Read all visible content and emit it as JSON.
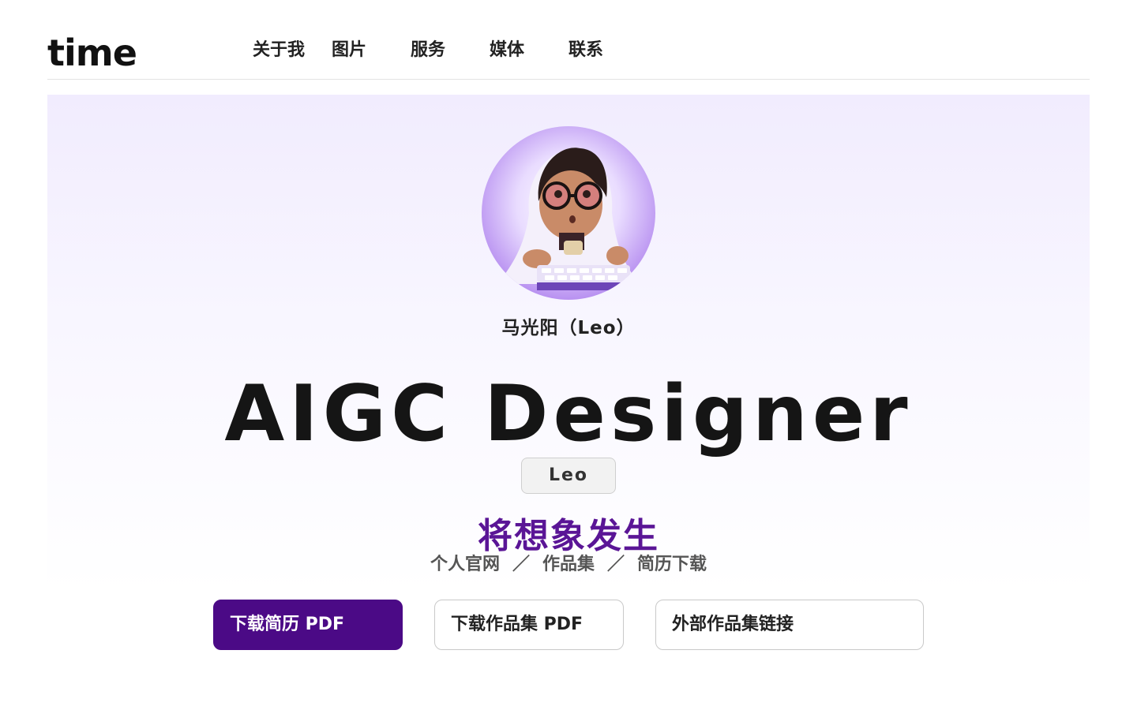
{
  "header": {
    "logo": "time",
    "nav": [
      {
        "label": "关于我"
      },
      {
        "label": "图片"
      },
      {
        "label": "服务"
      },
      {
        "label": "媒体"
      },
      {
        "label": "联系"
      }
    ]
  },
  "hero": {
    "avatar_icon": "avatar-illustration-hooded-coder",
    "name": "马光阳（Leo）",
    "headline": "AIGC Designer",
    "tag": "Leo",
    "slogan": "将想象发生",
    "links": [
      "个人官网",
      "作品集",
      "简历下载"
    ],
    "links_separator": "／"
  },
  "buttons": {
    "download_resume": "下载简历 PDF",
    "download_portfolio": "下载作品集 PDF",
    "external_portfolio": "外部作品集链接"
  },
  "colors": {
    "accent": "#4b0a86",
    "slogan": "#5a1596",
    "hero_bg_top": "#f1ecfe"
  }
}
